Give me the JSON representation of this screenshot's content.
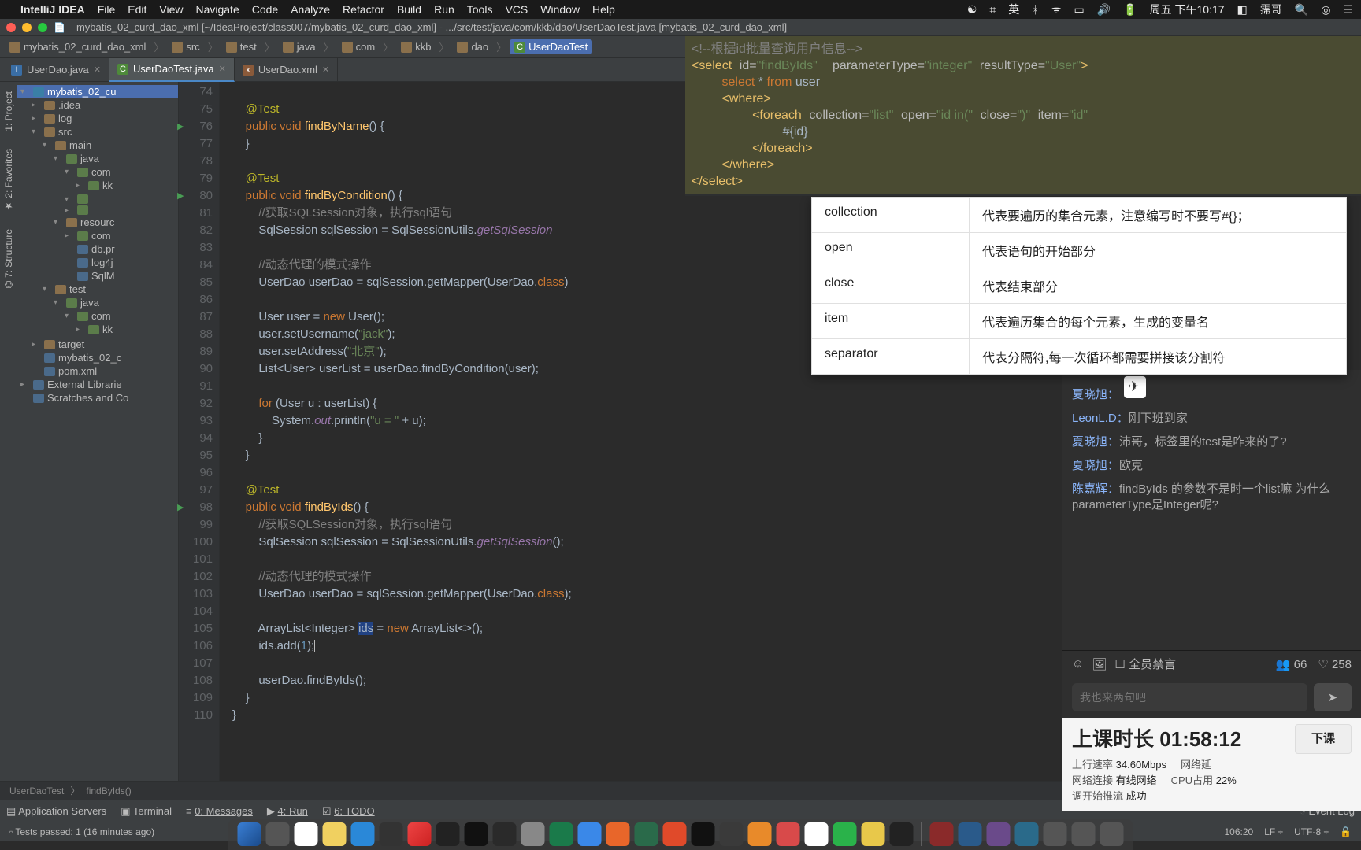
{
  "menubar": {
    "app": "IntelliJ IDEA",
    "items": [
      "File",
      "Edit",
      "View",
      "Navigate",
      "Code",
      "Analyze",
      "Refactor",
      "Build",
      "Run",
      "Tools",
      "VCS",
      "Window",
      "Help"
    ],
    "right": [
      "周五 下午10:17",
      "霈哥"
    ]
  },
  "window": {
    "title": "mybatis_02_curd_dao_xml [~/IdeaProject/class007/mybatis_02_curd_dao_xml] - .../src/test/java/com/kkb/dao/UserDaoTest.java [mybatis_02_curd_dao_xml]"
  },
  "breadcrumb": {
    "project": "mybatis_02_curd_dao_xml",
    "parts": [
      "src",
      "test",
      "java",
      "com",
      "kkb",
      "dao"
    ],
    "leaf": "UserDaoTest"
  },
  "tabs": [
    {
      "label": "UserDao.java",
      "active": false
    },
    {
      "label": "UserDaoTest.java",
      "active": true
    },
    {
      "label": "UserDao.xml",
      "active": false
    }
  ],
  "project_tree": [
    {
      "d": 0,
      "a": "▾",
      "i": "mod",
      "t": "mybatis_02_cu",
      "sel": true
    },
    {
      "d": 1,
      "a": "▸",
      "i": "folder",
      "t": ".idea"
    },
    {
      "d": 1,
      "a": "▸",
      "i": "folder",
      "t": "log"
    },
    {
      "d": 1,
      "a": "▾",
      "i": "folder",
      "t": "src"
    },
    {
      "d": 2,
      "a": "▾",
      "i": "folder",
      "t": "main"
    },
    {
      "d": 3,
      "a": "▾",
      "i": "pkg",
      "t": "java"
    },
    {
      "d": 4,
      "a": "▾",
      "i": "pkg",
      "t": "com"
    },
    {
      "d": 5,
      "a": "▸",
      "i": "pkg",
      "t": "kk"
    },
    {
      "d": 4,
      "a": "",
      "i": "",
      "t": ""
    },
    {
      "d": 4,
      "a": "▾",
      "i": "pkg",
      "t": ""
    },
    {
      "d": 4,
      "a": "▸",
      "i": "pkg",
      "t": ""
    },
    {
      "d": 3,
      "a": "▾",
      "i": "folder",
      "t": "resourc"
    },
    {
      "d": 4,
      "a": "▸",
      "i": "pkg",
      "t": "com"
    },
    {
      "d": 4,
      "a": "",
      "i": "file",
      "t": "db.pr"
    },
    {
      "d": 4,
      "a": "",
      "i": "file",
      "t": "log4j"
    },
    {
      "d": 4,
      "a": "",
      "i": "file",
      "t": "SqlM"
    },
    {
      "d": 2,
      "a": "▾",
      "i": "folder",
      "t": "test"
    },
    {
      "d": 3,
      "a": "▾",
      "i": "pkg",
      "t": "java"
    },
    {
      "d": 4,
      "a": "▾",
      "i": "pkg",
      "t": "com"
    },
    {
      "d": 5,
      "a": "▸",
      "i": "pkg",
      "t": "kk"
    },
    {
      "d": 5,
      "a": "",
      "i": "",
      "t": ""
    },
    {
      "d": 1,
      "a": "▸",
      "i": "folder",
      "t": "target"
    },
    {
      "d": 1,
      "a": "",
      "i": "file",
      "t": "mybatis_02_c"
    },
    {
      "d": 1,
      "a": "",
      "i": "file",
      "t": "pom.xml"
    },
    {
      "d": 0,
      "a": "▸",
      "i": "file",
      "t": "External Librarie"
    },
    {
      "d": 0,
      "a": "",
      "i": "file",
      "t": "Scratches and Co"
    }
  ],
  "gutter_start": 74,
  "gutter_marks": {
    "76": "run",
    "80": "run",
    "98": "run"
  },
  "code_path": {
    "a": "UserDaoTest",
    "b": "findByIds()"
  },
  "bottom_tools": {
    "left": [
      "Application Servers",
      "Terminal",
      "0: Messages",
      "4: Run",
      "6: TODO"
    ],
    "right": "Event Log"
  },
  "status": {
    "left": "Tests passed: 1 (16 minutes ago)",
    "pos": "106:20",
    "lf": "LF",
    "enc": "UTF-8"
  },
  "xml_overlay": {
    "comment": "<!--根据id批量查询用户信息-->"
  },
  "ref_table": [
    {
      "k": "collection",
      "v": "代表要遍历的集合元素，注意编写时不要写#{}；"
    },
    {
      "k": "open",
      "v": "代表语句的开始部分"
    },
    {
      "k": "close",
      "v": "代表结束部分"
    },
    {
      "k": "item",
      "v": "代表遍历集合的每个元素，生成的变量名"
    },
    {
      "k": "separator",
      "v": "代表分隔符,每一次循环都需要拼接该分割符"
    }
  ],
  "chat": {
    "msgs": [
      {
        "u": "夏晓旭：",
        "t": "",
        "avatar": true
      },
      {
        "u": "LeonL.D：",
        "t": "刚下班到家"
      },
      {
        "u": "夏晓旭：",
        "t": "沛哥，标签里的test是咋来的了?"
      },
      {
        "u": "夏晓旭：",
        "t": "欧克"
      },
      {
        "u": "陈嘉辉：",
        "t": "findByIds 的参数不是时一个list嘛 为什么parameterType是Integer呢?"
      }
    ],
    "mute_label": "全员禁言",
    "viewers": "66",
    "likes": "258",
    "placeholder": "我也来两句吧",
    "class_label": "上课时长",
    "class_time": "01:58:12",
    "end_btn": "下课",
    "stats": {
      "up_lbl": "上行速率",
      "up": "34.60Mbps",
      "lat_lbl": "网络延",
      "net_lbl": "网络连接",
      "net": "有线网络",
      "cpu_lbl": "CPU占用",
      "cpu": "22%",
      "push_lbl": "调开始推流",
      "push": "成功"
    }
  }
}
